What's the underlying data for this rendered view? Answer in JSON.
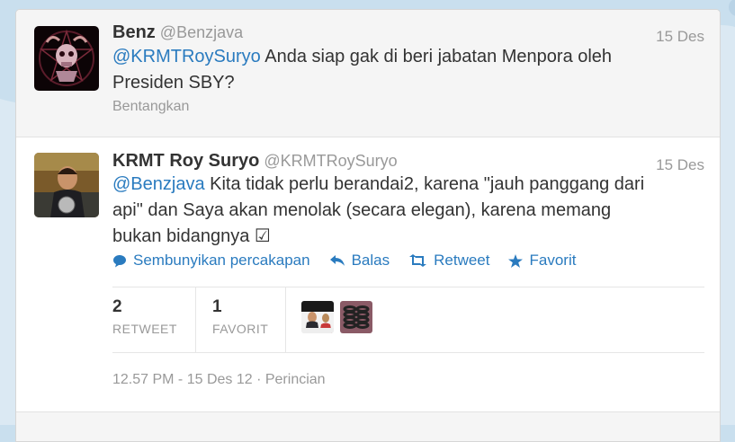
{
  "tweets": [
    {
      "name": "Benz",
      "handle": "@Benzjava",
      "time": "15 Des",
      "mention": "@KRMTRoySuryo",
      "text": " Anda siap gak di beri jabatan Menpora oleh Presiden SBY?",
      "expand_label": "Bentangkan"
    },
    {
      "name": "KRMT Roy Suryo",
      "handle": "@KRMTRoySuryo",
      "time": "15 Des",
      "mention": "@Benzjava",
      "text": " Kita tidak perlu berandai2, karena \"jauh panggang dari api\" dan Saya akan menolak (secara elegan), karena memang bukan bidangnya ☑",
      "actions": {
        "hide": "Sembunyikan percakapan",
        "reply": "Balas",
        "retweet": "Retweet",
        "favorite": "Favorit"
      },
      "stats": {
        "retweet_count": "2",
        "retweet_label": "RETWEET",
        "favorite_count": "1",
        "favorite_label": "FAVORIT"
      },
      "timestamp": "12.57 PM - 15 Des 12",
      "details": "Perincian"
    }
  ],
  "colors": {
    "link": "#2a7bbf",
    "page_background": "#c9dfee",
    "muted_text": "#999999"
  },
  "icons": {
    "hide": "speech-bubble-icon",
    "reply": "reply-arrow-icon",
    "retweet": "retweet-icon",
    "favorite": "star-icon"
  }
}
